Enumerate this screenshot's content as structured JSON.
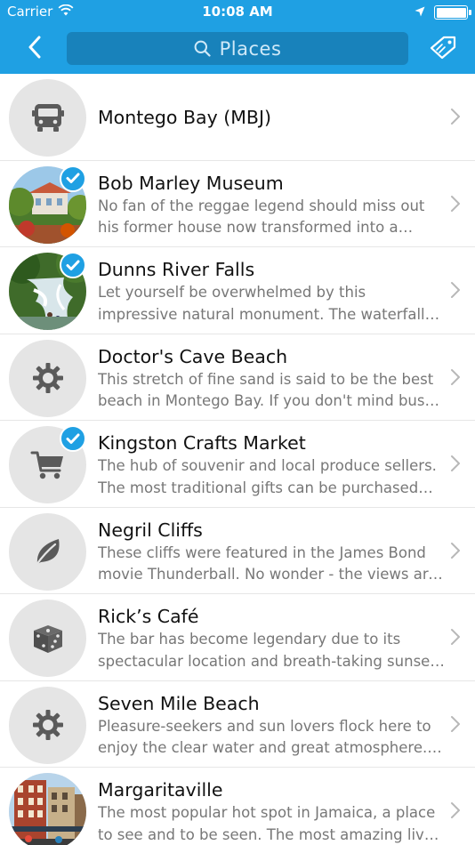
{
  "status_bar": {
    "carrier": "Carrier",
    "time": "10:08 AM"
  },
  "nav": {
    "search_placeholder": "Places",
    "back_icon": "chevron-left-icon",
    "tag_icon": "tag-icon"
  },
  "colors": {
    "accent": "#1fa0e3",
    "search_bg": "#1882bb",
    "check": "#1fa0e3"
  },
  "places": [
    {
      "title": "Montego Bay (MBJ)",
      "description": "",
      "icon": "bus-icon",
      "checked": false
    },
    {
      "title": "Bob Marley Museum",
      "description": "No fan of the reggae legend should miss out his former house now transformed into a museum.",
      "icon": "photo-museum",
      "checked": true
    },
    {
      "title": "Dunns River Falls",
      "description": "Let yourself be overwhelmed by this impressive natural monument. The waterfalls cascade down.",
      "icon": "photo-falls",
      "checked": true
    },
    {
      "title": "Doctor's Cave Beach",
      "description": "This stretch of fine sand is said to be the best beach in Montego Bay. If you don't mind busy crowds.",
      "icon": "gear-icon",
      "checked": false
    },
    {
      "title": "Kingston Crafts Market",
      "description": "The hub of souvenir and local produce sellers. The most traditional gifts can be purchased here.",
      "icon": "cart-icon",
      "checked": true
    },
    {
      "title": "Negril Cliffs",
      "description": "These cliffs were featured in the James Bond movie Thunderball. No wonder - the views are stunning.",
      "icon": "leaf-icon",
      "checked": false
    },
    {
      "title": "Rick’s Café",
      "description": "The bar has become legendary due to its spectacular location and breath-taking sunset views.",
      "icon": "dice-icon",
      "checked": false
    },
    {
      "title": "Seven Mile Beach",
      "description": "Pleasure-seekers and sun lovers flock here to enjoy the clear water and great atmosphere. Relax.",
      "icon": "gear-icon",
      "checked": false
    },
    {
      "title": "Margaritaville",
      "description": "The most popular hot spot in Jamaica, a place to see and to be seen. The most amazing live music.",
      "icon": "photo-street",
      "checked": false
    }
  ]
}
